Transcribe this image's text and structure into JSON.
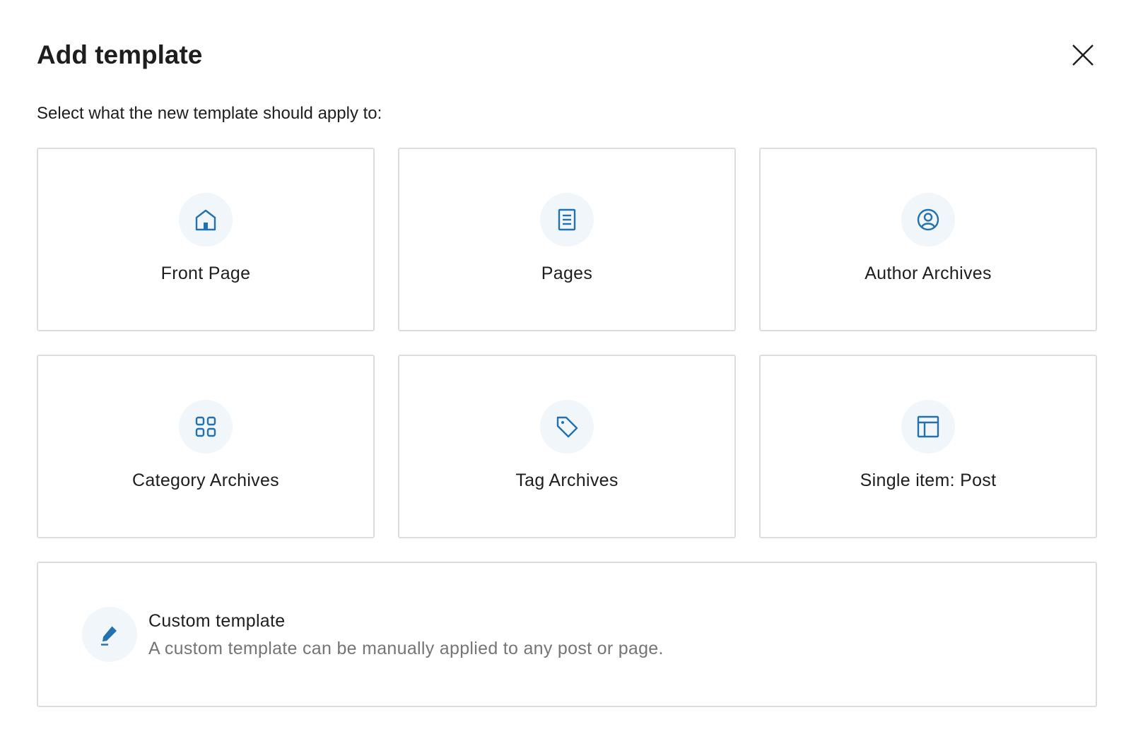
{
  "dialog": {
    "title": "Add template",
    "close_icon": "close-icon",
    "subtitle": "Select what the new template should apply to:"
  },
  "accent_color": "#2271b1",
  "icon_bg_color": "#f1f6fa",
  "template_options": [
    {
      "label": "Front Page",
      "icon": "home-icon"
    },
    {
      "label": "Pages",
      "icon": "page-icon"
    },
    {
      "label": "Author Archives",
      "icon": "author-icon"
    },
    {
      "label": "Category Archives",
      "icon": "category-icon"
    },
    {
      "label": "Tag Archives",
      "icon": "tag-icon"
    },
    {
      "label": "Single item: Post",
      "icon": "layout-icon"
    }
  ],
  "custom_template": {
    "title": "Custom template",
    "description": "A custom template can be manually applied to any post or page.",
    "icon": "pencil-icon"
  }
}
